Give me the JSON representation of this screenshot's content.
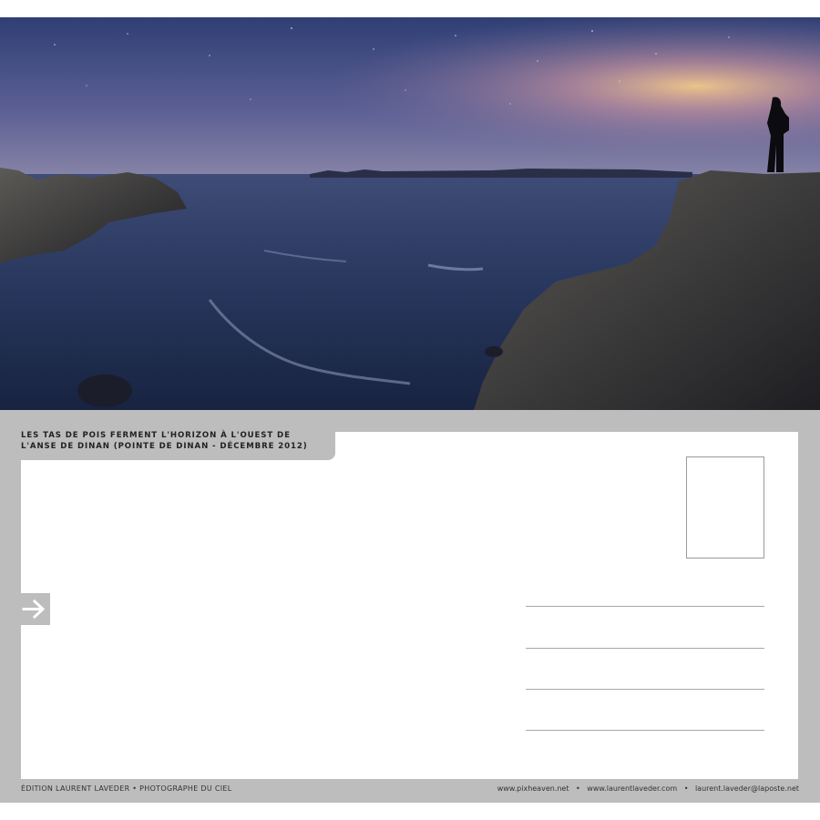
{
  "caption": {
    "line1": "LES TAS DE POIS FERMENT L'HORIZON À L'OUEST DE",
    "line2": "L'ANSE DE DINAN (POINTE DE DINAN - DÉCEMBRE 2012)"
  },
  "footer": {
    "left": "ÉDITION LAURENT LAVEDER • PHOTOGRAPHE DU CIEL",
    "links": [
      "www.pixheaven.net",
      "www.laurentlaveder.com",
      "laurent.laveder@laposte.net"
    ],
    "separator": "•"
  },
  "icons": {
    "arrow": "arrow-right-icon"
  },
  "colors": {
    "frame": "#bdbdbd",
    "paper": "#ffffff"
  }
}
